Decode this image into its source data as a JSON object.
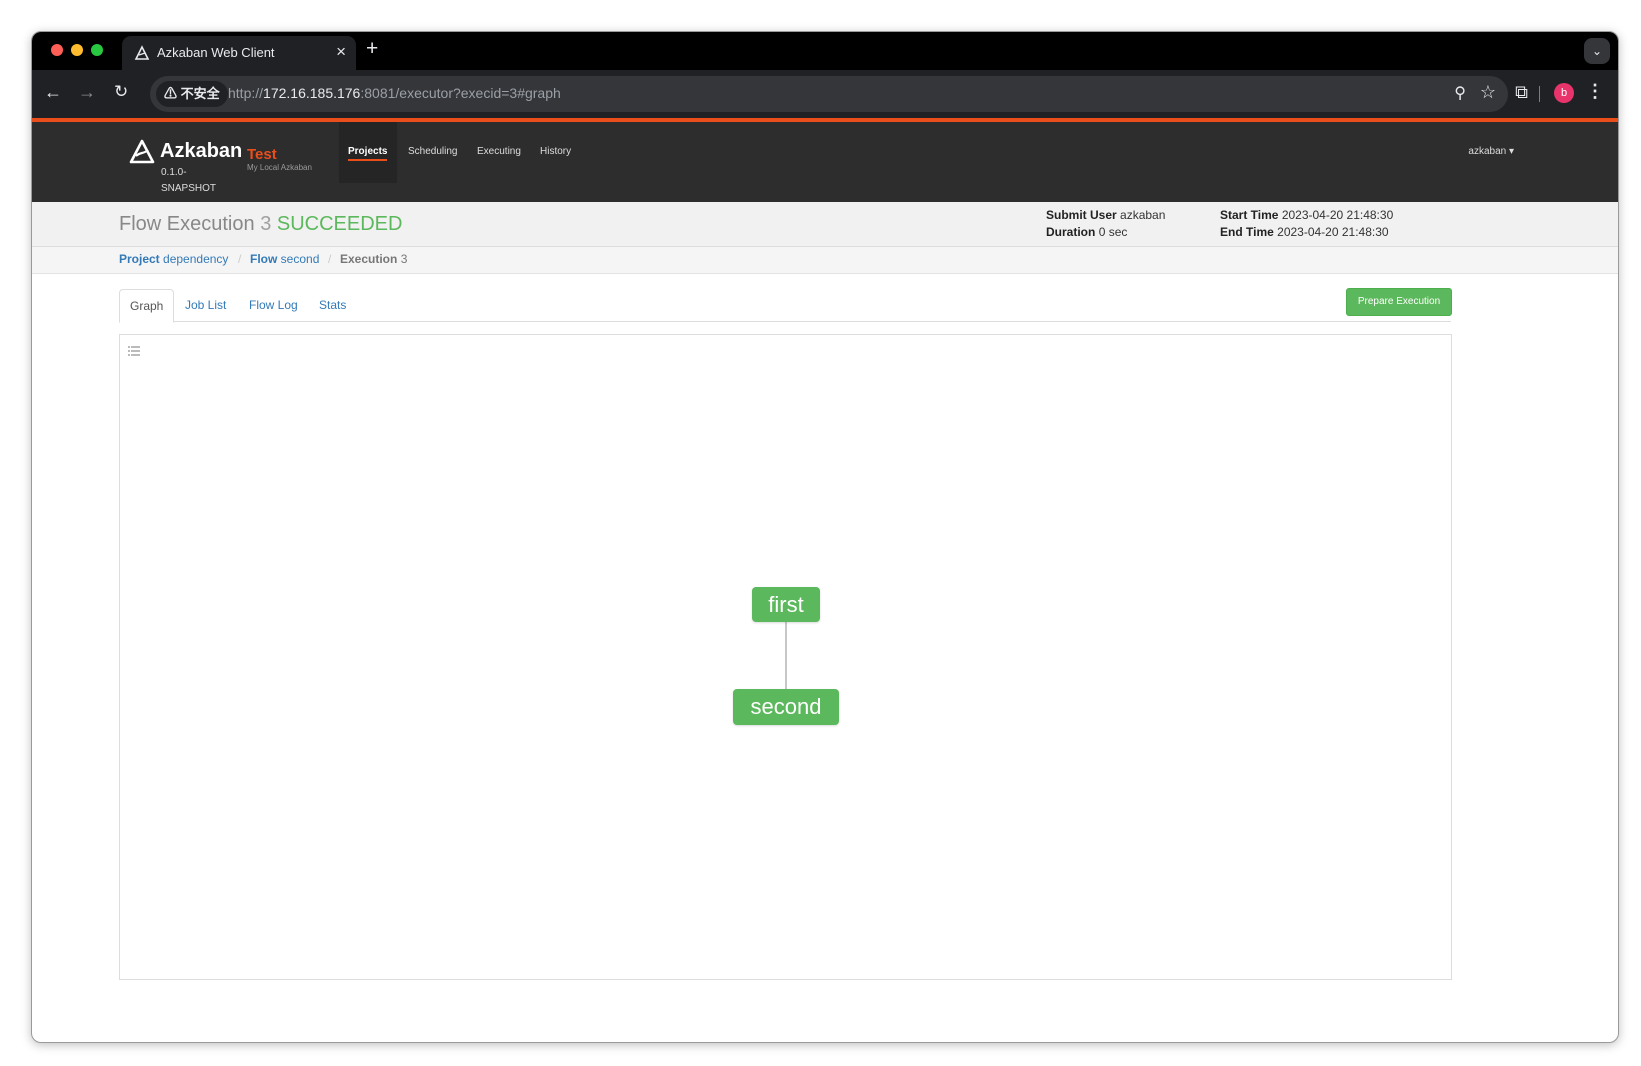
{
  "browser": {
    "tab_title": "Azkaban Web Client",
    "new_tab": "+",
    "tab_close": "×",
    "insecure_label": "⚠ 不安全",
    "url_scheme": "http://",
    "url_host": "172.16.185.176",
    "url_rest": ":8081/executor?execid=3#graph",
    "avatar_letter": "b"
  },
  "header": {
    "brand": "Azkaban",
    "version": "0.1.0-SNAPSHOT",
    "env_name": "Test",
    "env_desc": "My Local Azkaban",
    "nav": {
      "projects": "Projects",
      "scheduling": "Scheduling",
      "executing": "Executing",
      "history": "History"
    },
    "user_menu": "azkaban ▾",
    "accent_color": "#e94e1b"
  },
  "flow": {
    "title_prefix": "Flow Execution",
    "exec_id": "3",
    "status": "SUCCEEDED",
    "status_color": "#5cb85c",
    "submit_user_label": "Submit User",
    "submit_user": "azkaban",
    "duration_label": "Duration",
    "duration": "0 sec",
    "start_time_label": "Start Time",
    "start_time": "2023-04-20 21:48:30",
    "end_time_label": "End Time",
    "end_time": "2023-04-20 21:48:30"
  },
  "breadcrumb": {
    "project_label": "Project",
    "project": "dependency",
    "sep": "/",
    "flow_label": "Flow",
    "flow": "second",
    "exec_label": "Execution",
    "exec": "3"
  },
  "tabs": {
    "graph": "Graph",
    "job_list": "Job List",
    "flow_log": "Flow Log",
    "stats": "Stats"
  },
  "actions": {
    "prepare_execution": "Prepare Execution"
  },
  "graph": {
    "nodes": [
      {
        "id": "first",
        "label": "first",
        "status": "SUCCEEDED"
      },
      {
        "id": "second",
        "label": "second",
        "status": "SUCCEEDED"
      }
    ],
    "edges": [
      {
        "from": "first",
        "to": "second"
      }
    ]
  }
}
